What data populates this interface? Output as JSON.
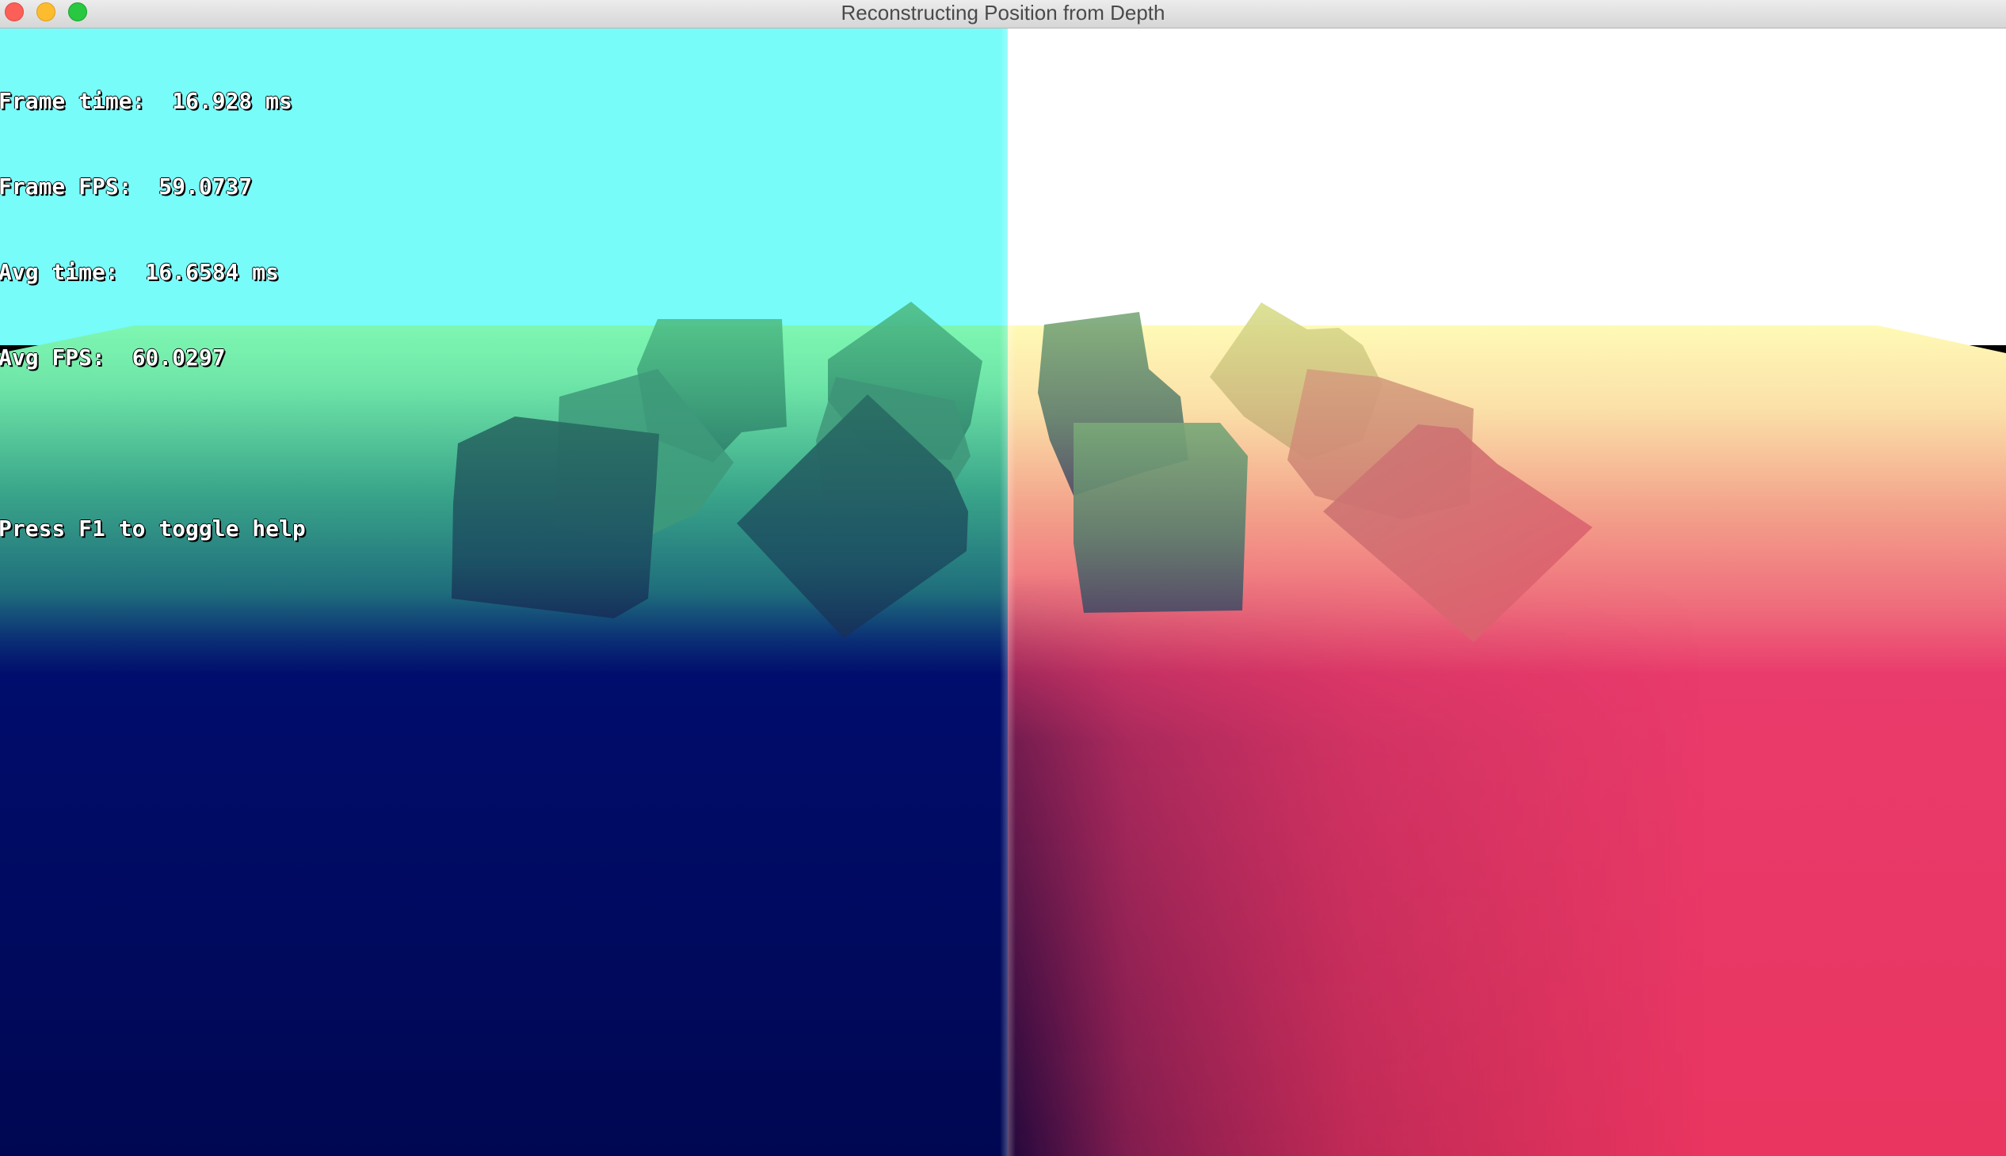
{
  "window": {
    "title": "Reconstructing Position from Depth"
  },
  "hud": {
    "frame_time": "Frame time:  16.928 ms",
    "frame_fps": "Frame FPS:  59.0737",
    "avg_time": "Avg time:  16.6584 ms",
    "avg_fps": "Avg FPS:  60.0297",
    "help_hint": "Press F1 to toggle help"
  },
  "colors": {
    "close": "#fc5f57",
    "minimize": "#fdbc2e",
    "maximize": "#28c840",
    "left_sky": "#77fcfa",
    "right_sky": "#ffffff",
    "left_floor": "#000b66",
    "right_floor": "#ea3463"
  }
}
